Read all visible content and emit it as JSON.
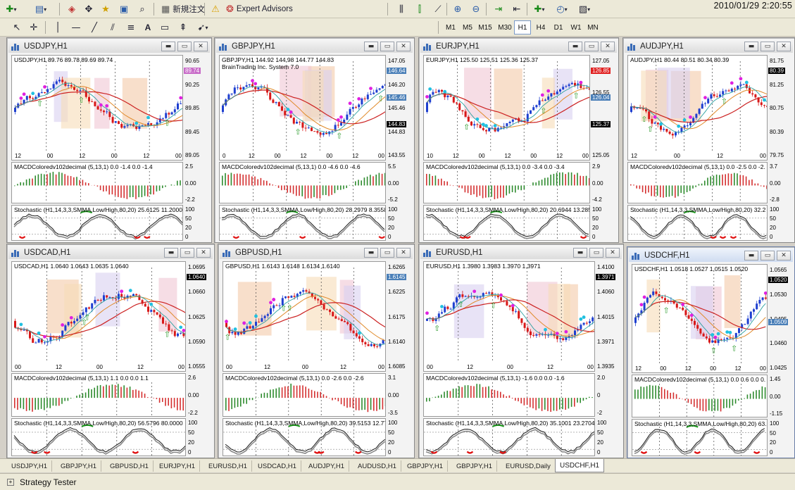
{
  "clock": "2010/01/29 2:20:55",
  "toolbar": {
    "new_order_label": "新規注文",
    "expert_advisors_label": "Expert Advisors",
    "timeframes": [
      "M1",
      "M5",
      "M15",
      "M30",
      "H1",
      "H4",
      "D1",
      "W1",
      "MN"
    ],
    "active_timeframe": "H1"
  },
  "windows": [
    {
      "id": "usdjpy",
      "title": "USDJPY,H1",
      "active": false,
      "info": "USDJPY,H1  89.76 89.78 89.69 89.74",
      "info2": "",
      "scale": [
        "90.65",
        "90.25",
        "89.85",
        "89.45",
        "89.05"
      ],
      "tags": [
        {
          "text": "89.74",
          "color": "#c86bc8"
        }
      ],
      "xlabels": [
        "12",
        "00",
        "12",
        "00",
        "12",
        "00"
      ],
      "macd_title": "MACDColoredv102decimal (5,13,1) 0.0 -1.4 0.0 -1.4",
      "macd_scale": [
        "2.5",
        "0.00",
        "-2.2"
      ],
      "stoch_title": "Stochastic (H1,14,3,3,SMMA,Low/High,80,20) 25.6125 11.2000",
      "stoch_scale": [
        "100",
        "50",
        "20",
        "0"
      ]
    },
    {
      "id": "gbpjpy",
      "title": "GBPJPY,H1",
      "active": false,
      "info": "GBPJPY,H1  144.92 144.98 144.77 144.83",
      "info2": "BrainTrading Inc. System 7.0",
      "scale": [
        "147.05",
        "146.20",
        "145.46",
        "144.83",
        "143.55"
      ],
      "tags": [
        {
          "text": "146.64",
          "color": "#4a7fb8"
        },
        {
          "text": "145.46",
          "color": "#4a7fb8"
        },
        {
          "text": "144.83",
          "color": "#000000"
        }
      ],
      "xlabels": [
        "0",
        "12",
        "00",
        "12",
        "00",
        "12",
        "00"
      ],
      "macd_title": "MACDColoredv102decimal (5,13,1) 0.0 -4.6 0.0 -4.6",
      "macd_scale": [
        "5.5",
        "0.00",
        "-5.2"
      ],
      "stoch_title": "Stochastic (H1,14,3,3,SMMA,Low/High,80,20) 28.2979 8.3558",
      "stoch_scale": [
        "100",
        "50",
        "20",
        "0"
      ]
    },
    {
      "id": "eurjpy",
      "title": "EURJPY,H1",
      "active": false,
      "info": "EURJPY,H1  125.50 125.51 125.36 125.37",
      "info2": "",
      "scale": [
        "127.05",
        "126.55",
        "125.55",
        "125.05"
      ],
      "tags": [
        {
          "text": "126.85",
          "color": "#e02020"
        },
        {
          "text": "126.04",
          "color": "#4a7fb8"
        },
        {
          "text": "125.37",
          "color": "#000000"
        }
      ],
      "xlabels": [
        "10",
        "12",
        "00",
        "12",
        "00",
        "12",
        "00"
      ],
      "macd_title": "MACDColoredv102decimal (5,13,1) 0.0 -3.4 0.0 -3.4",
      "macd_scale": [
        "2.9",
        "0.00",
        "-4.2"
      ],
      "stoch_title": "Stochastic (H1,14,3,3,SMMA,Low/High,80,20) 20.6944 13.285",
      "stoch_scale": [
        "100",
        "50",
        "20",
        "0"
      ]
    },
    {
      "id": "audjpy",
      "title": "AUDJPY,H1",
      "active": false,
      "info": "AUDJPY,H1  80.44 80.51 80.34 80.39",
      "info2": "",
      "scale": [
        "81.75",
        "81.25",
        "80.75",
        "80.39",
        "79.75"
      ],
      "tags": [
        {
          "text": "80.39",
          "color": "#000000"
        }
      ],
      "xlabels": [
        "12",
        "00",
        "12",
        "00"
      ],
      "macd_title": "MACDColoredv102decimal (5,13,1) 0.0 -2.5 0.0 -2.",
      "macd_scale": [
        "3.7",
        "0.00",
        "-2.8"
      ],
      "stoch_title": "Stochastic (H1,14,3,3,SMMA,Low/High,80,20) 32.2",
      "stoch_scale": [
        "100",
        "50",
        "20",
        "0"
      ]
    },
    {
      "id": "usdcad",
      "title": "USDCAD,H1",
      "active": false,
      "info": "USDCAD,H1  1.0640 1.0643 1.0635 1.0640",
      "info2": "",
      "scale": [
        "1.0695",
        "1.0660",
        "1.0625",
        "1.0590",
        "1.0555"
      ],
      "tags": [
        {
          "text": "1.0640",
          "color": "#000000"
        }
      ],
      "xlabels": [
        "00",
        "12",
        "00",
        "12",
        "00"
      ],
      "macd_title": "MACDColoredv102decimal (5,13,1) 1.1 0.0 0.0 1.1",
      "macd_scale": [
        "2.6",
        "0.00",
        "-2.2"
      ],
      "stoch_title": "Stochastic (H1,14,3,3,SMMA,Low/High,80,20) 56.5796 80.0000",
      "stoch_scale": [
        "100",
        "50",
        "20",
        "0"
      ]
    },
    {
      "id": "gbpusd",
      "title": "GBPUSD,H1",
      "active": false,
      "info": "GBPUSD,H1  1.6143 1.6148 1.6134 1.6140",
      "info2": "",
      "scale": [
        "1.6265",
        "1.6225",
        "1.6175",
        "1.6140",
        "1.6085"
      ],
      "tags": [
        {
          "text": "1.6145",
          "color": "#4a7fb8"
        }
      ],
      "xlabels": [
        "00",
        "12",
        "00",
        "12",
        "00"
      ],
      "macd_title": "MACDColoredv102decimal (5,13,1) 0.0 -2.6 0.0 -2.6",
      "macd_scale": [
        "3.1",
        "0.00",
        "-3.5"
      ],
      "stoch_title": "Stochastic (H1,14,3,3,SMMA,Low/High,80,20) 39.5153 12.7706",
      "stoch_scale": [
        "100",
        "50",
        "20",
        "0"
      ]
    },
    {
      "id": "eurusd",
      "title": "EURUSD,H1",
      "active": false,
      "info": "EURUSD,H1  1.3980 1.3983 1.3970 1.3971",
      "info2": "",
      "scale": [
        "1.4100",
        "1.4060",
        "1.4015",
        "1.3971",
        "1.3935"
      ],
      "tags": [
        {
          "text": "1.3971",
          "color": "#000000"
        }
      ],
      "xlabels": [
        "00",
        "12",
        "00",
        "12",
        "00"
      ],
      "macd_title": "MACDColoredv102decimal (5,13,1) -1.6 0.0 0.0 -1.6",
      "macd_scale": [
        "2.0",
        "0",
        "-2"
      ],
      "stoch_title": "Stochastic (H1,14,3,3,SMMA,Low/High,80,20) 35.1001 23.2704",
      "stoch_scale": [
        "100",
        "50",
        "20",
        "0"
      ]
    },
    {
      "id": "usdchf",
      "title": "USDCHF,H1",
      "active": true,
      "info": "USDCHF,H1  1.0518 1.0527 1.0515 1.0520",
      "info2": "",
      "scale": [
        "1.0565",
        "1.0530",
        "1.0495",
        "1.0460",
        "1.0425"
      ],
      "tags": [
        {
          "text": "1.0520",
          "color": "#000000"
        },
        {
          "text": "1.0509",
          "color": "#4a7fb8"
        }
      ],
      "xlabels": [
        "12",
        "00",
        "12",
        "00",
        "12",
        "00"
      ],
      "macd_title": "MACDColoredv102decimal (5,13,1) 0.0 0.6 0.0 0.",
      "macd_scale": [
        "1.45",
        "0.00",
        "-1.15"
      ],
      "stoch_title": "Stochastic (H1,14,3,3,SMMA,Low/High,80,20) 63.",
      "stoch_scale": [
        "100",
        "50",
        "20",
        "0"
      ]
    }
  ],
  "tabs": [
    "USDJPY,H1",
    "GBPJPY,H1",
    "GBPUSD,H1",
    "EURJPY,H1",
    "EURUSD,H1",
    "USDCAD,H1",
    "AUDJPY,H1",
    "AUDUSD,H1",
    "GBPJPY,H1",
    "GBPJPY,H1",
    "EURUSD,Daily",
    "USDCHF,H1"
  ],
  "selected_tab": "USDCHF,H1",
  "status": {
    "strategy_tester_label": "Strategy Tester"
  },
  "colors": {
    "bull": "#1e3fd0",
    "bear": "#d81818",
    "macd_up": "#2e8b2e",
    "macd_down": "#d43030",
    "stoch_main": "#1a1a1a",
    "stoch_signal": "#8a8a8a"
  }
}
